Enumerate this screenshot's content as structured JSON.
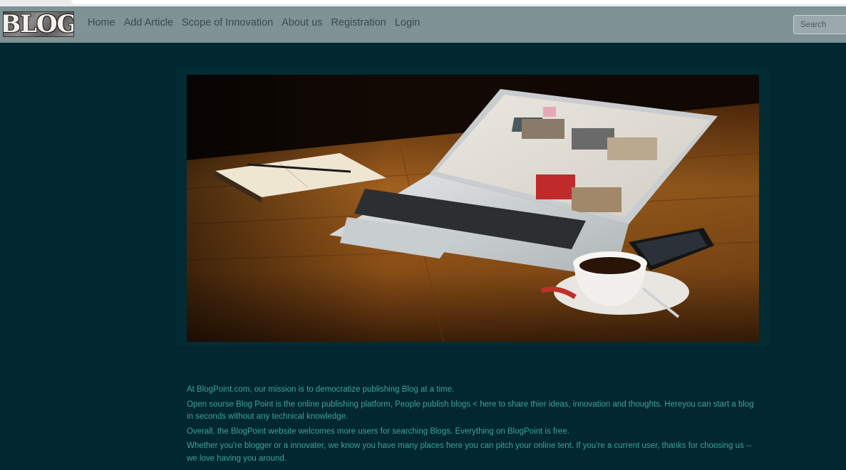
{
  "nav": {
    "logo_text": "BLOG",
    "links": [
      "Home",
      "Add Article",
      "Scope of Innovation",
      "About us",
      "Registration",
      "Login"
    ],
    "search_placeholder": "Search"
  },
  "hero": {
    "image_name": "laptop-on-wooden-table-photo"
  },
  "content": {
    "paragraphs": [
      "At BlogPoint.com, our mission is to democratize publishing Blog at a time.",
      "Open sourse Blog Point is the online publishing platform, People publish blogs < here to share thier ideas, innovation and thoughts. Hereyou can start a blog in seconds without any technical knowledge.",
      "Overall, the BlogPoint website welcomes more users for searching Blogs. Everything on BlogPoint is free.",
      "Whether you're blogger or a innovater, we know you have many places here you can pitch your online tent. If you're a current user, thanks for choosing us -- we love having you around."
    ]
  },
  "colors": {
    "page_background": "#012730",
    "navbar_background": "#7f9295",
    "body_text": "#3fa396"
  }
}
